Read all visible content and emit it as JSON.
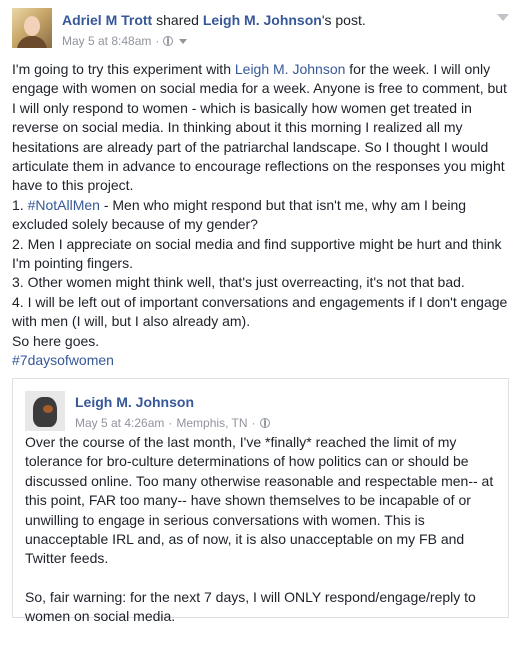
{
  "post": {
    "author": "Adriel M Trott",
    "action": "shared",
    "shared_from": "Leigh M. Johnson",
    "shared_suffix": "'s post.",
    "date": "May 5 at 8:48am",
    "separator": "·",
    "body": [
      [
        "I'm going to try this experiment with ",
        {
          "link": "Leigh M. Johnson"
        },
        " for the week. I will only engage with women on social media for a week. Anyone is free to comment, but I will only respond to women - which is basically how women get treated in reverse on social media. In thinking about it this morning I realized all my hesitations are already part of the patriarchal landscape. So I thought I would articulate them in advance to encourage reflections on the responses you might have to this project."
      ],
      [
        "1. ",
        {
          "link": "#NotAllMen"
        },
        " - Men who might respond but that isn't me, why am I being excluded solely because of my gender?"
      ],
      [
        "2. Men I appreciate on social media and find supportive might be hurt and think I'm pointing fingers."
      ],
      [
        "3. Other women might think well, that's just overreacting, it's not that bad."
      ],
      [
        "4. I will be left out of important conversations and engagements if I don't engage with men (I will, but I also already am)."
      ],
      [
        "So here goes."
      ],
      [
        {
          "link": "#7daysofwomen"
        }
      ]
    ]
  },
  "shared_post": {
    "author": "Leigh M. Johnson",
    "date": "May 5 at 4:26am",
    "separator": "·",
    "location": "Memphis, TN",
    "paragraphs": [
      "Over the course of the last month, I've *finally* reached the limit of my tolerance for bro-culture determinations of how politics can or should be discussed online. Too many otherwise reasonable and respectable men-- at this point, FAR too many-- have shown themselves to be incapable of or unwilling to engage in serious conversations with women. This is unacceptable IRL and, as of now, it is also unacceptable on my FB and Twitter feeds.",
      "So, fair warning: for the next 7 days, I will ONLY respond/engage/reply to women on social media."
    ]
  },
  "colors": {
    "link": "#365899",
    "text": "#1d2129",
    "meta": "#90949c",
    "border": "#dddfe2"
  },
  "icons": [
    "globe-icon",
    "chevron-down-icon"
  ]
}
